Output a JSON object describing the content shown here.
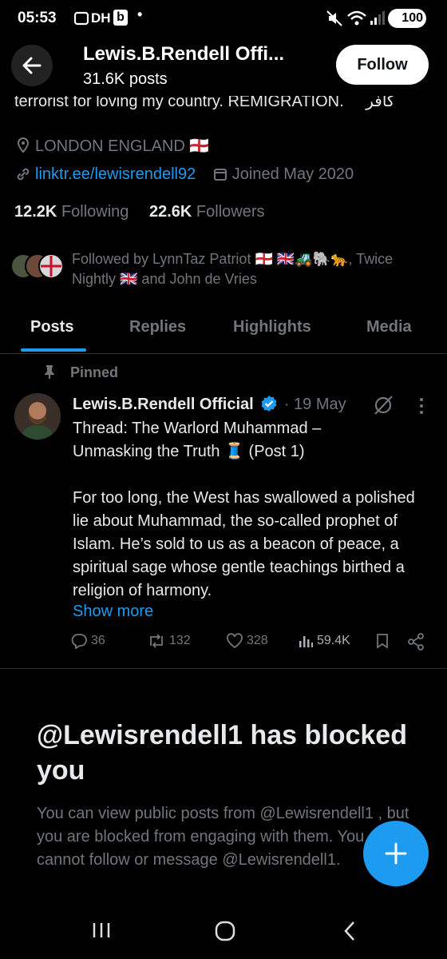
{
  "status_bar": {
    "time": "05:53",
    "apps": "DH",
    "app_b": "b",
    "battery": "100"
  },
  "header": {
    "name": "Lewis.B.Rendell Offi...",
    "posts": "31.6K posts",
    "follow_label": "Follow"
  },
  "profile": {
    "bio_clip": "terrorist for loving my country. REMIGRATION.",
    "bio_arabic": "كافر",
    "location": "LONDON ENGLAND 🏴󠁧󠁢󠁥󠁮󠁧󠁿",
    "link": "linktr.ee/lewisrendell92",
    "joined": "Joined May 2020",
    "following_count": "12.2K",
    "following_label": "Following",
    "followers_count": "22.6K",
    "followers_label": "Followers",
    "mutuals_line1": "Followed by LynnTaz Patriot 🏴󠁧󠁢󠁥󠁮󠁧󠁿 🇬🇧🚜🐘🐆, Twice",
    "mutuals_line2": "Nightly 🇬🇧 and John de Vries"
  },
  "tabs": [
    "Posts",
    "Replies",
    "Highlights",
    "Media"
  ],
  "tweet": {
    "pinned_label": "Pinned",
    "author": "Lewis.B.Rendell Official",
    "date": "· 19 May",
    "line1": "Thread: The Warlord Muhammad –",
    "line2": "Unmasking the Truth 🧵 (Post 1)",
    "paragraph": "For too long, the West has swallowed a polished lie about Muhammad, the so-called prophet of Islam. He’s sold to us as a beacon of peace, a spiritual sage whose gentle teachings birthed a religion of harmony.",
    "show_more": "Show more",
    "replies": "36",
    "reposts": "132",
    "likes": "328",
    "views": "59.4K"
  },
  "blocked": {
    "title": "@Lewisrendell1 has blocked you",
    "text": "You can view public posts from @Lewisrendell1 , but you are blocked from engaging with them. You also cannot follow or message @Lewisrendell1."
  },
  "colors": {
    "accent": "#1d9bf0",
    "muted": "#71767b",
    "background": "#000000"
  }
}
